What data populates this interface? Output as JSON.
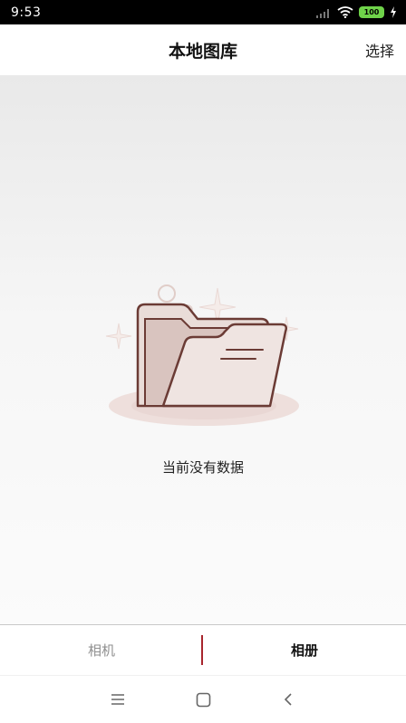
{
  "status_bar": {
    "time": "9:53",
    "battery": "100"
  },
  "header": {
    "title": "本地图库",
    "select_label": "选择"
  },
  "empty_state": {
    "message": "当前没有数据",
    "icon": "folder-icon"
  },
  "tabs": [
    {
      "label": "相机",
      "active": false
    },
    {
      "label": "相册",
      "active": true
    }
  ],
  "nav_bar": {
    "icons": [
      "menu-icon",
      "home-icon",
      "back-icon"
    ]
  },
  "colors": {
    "accent": "#a8252d",
    "folder_stroke": "#6b3b35",
    "folder_fill": "#efe4e1",
    "folder_back": "#d9c4bf"
  }
}
